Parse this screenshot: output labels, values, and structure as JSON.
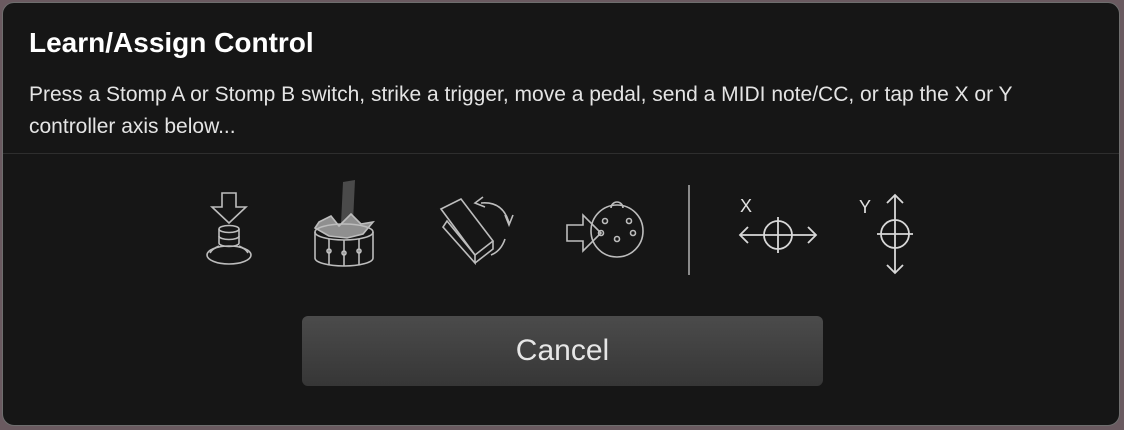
{
  "dialog": {
    "title": "Learn/Assign Control",
    "message": "Press a Stomp A or Stomp B switch, strike a trigger, move a pedal, send a MIDI note/CC, or tap the X or Y controller axis below..."
  },
  "icons": [
    {
      "name": "stomp-switch-icon"
    },
    {
      "name": "drum-trigger-icon"
    },
    {
      "name": "expression-pedal-icon"
    },
    {
      "name": "midi-input-icon"
    }
  ],
  "axes": {
    "x": {
      "letter": "X",
      "icon": "x-axis-crosshair-icon"
    },
    "y": {
      "letter": "Y",
      "icon": "y-axis-crosshair-icon"
    }
  },
  "cancel_label": "Cancel",
  "colors": {
    "background": "#161616",
    "border": "#6e6e6e",
    "icon_stroke": "#bdbdbd",
    "button": "#404040"
  }
}
